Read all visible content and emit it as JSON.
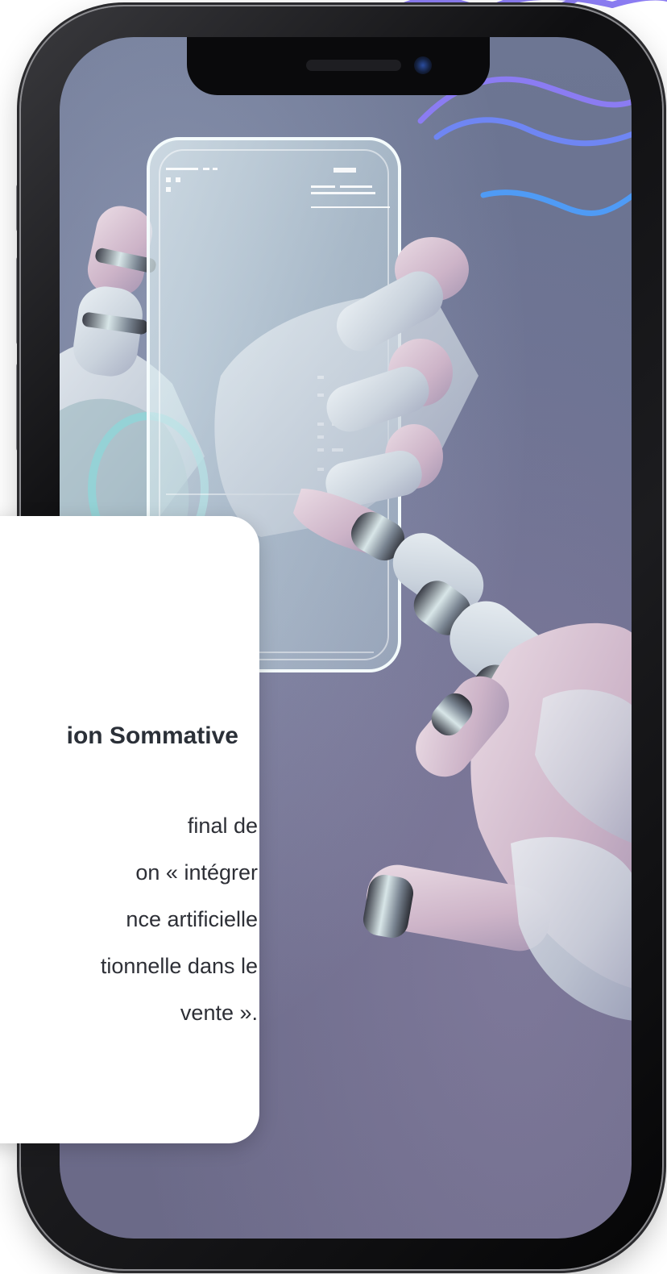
{
  "card": {
    "title": "ion Sommative",
    "lines": [
      "final de",
      "on « intégrer",
      "nce artificielle",
      "tionnelle dans le",
      "vente »."
    ]
  },
  "colors": {
    "screen_background": "#6b7190",
    "card_background": "#ffffff",
    "card_text": "#2d2f36",
    "wave_purple": "#8b7cf2",
    "wave_blue": "#4f9bf5",
    "phone_frame": "#111113"
  },
  "icons": {
    "camera": "camera-icon",
    "speaker": "speaker-grille"
  }
}
